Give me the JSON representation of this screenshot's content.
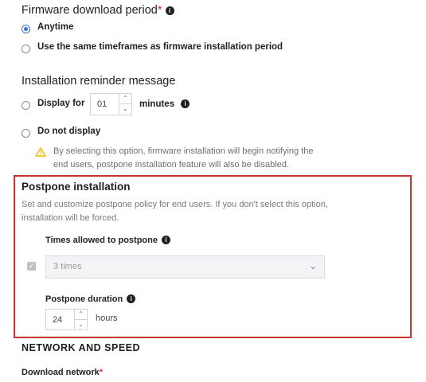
{
  "firmware_download": {
    "title": "Firmware download period",
    "required_mark": "*",
    "options": [
      {
        "label": "Anytime",
        "selected": true
      },
      {
        "label": "Use the same timeframes as firmware installation period",
        "selected": false
      }
    ]
  },
  "reminder": {
    "title": "Installation reminder message",
    "display_for_label": "Display for",
    "display_for_value": "01",
    "display_for_unit": "minutes",
    "do_not_display_label": "Do not display",
    "warning_line1": "By selecting this option, firmware installation will begin notifying the",
    "warning_line2": "end users, postpone installation feature will also be disabled."
  },
  "postpone": {
    "title": "Postpone installation",
    "desc_line1": "Set and customize postpone policy for end users. If you don't select this option,",
    "desc_line2": "installation will be forced.",
    "times_label": "Times allowed to postpone",
    "times_value": "3 times",
    "duration_label": "Postpone duration",
    "duration_value": "24",
    "duration_unit": "hours"
  },
  "network": {
    "title": "NETWORK AND SPEED",
    "download_label": "Download network",
    "required_mark": "*"
  },
  "icons": {
    "info": "info-icon",
    "warning": "warning-icon",
    "chevron": "chevron-down-icon",
    "check": "checkbox-check-icon"
  },
  "colors": {
    "accent": "#3b6fd8",
    "highlight": "#c8332f",
    "warning": "#f2b705",
    "required": "#d9302c"
  }
}
